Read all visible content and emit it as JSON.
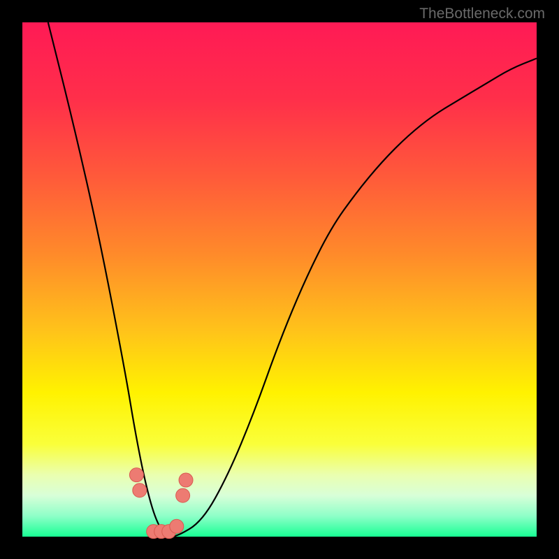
{
  "watermark": "TheBottleneck.com",
  "chart_data": {
    "type": "line",
    "title": "",
    "xlabel": "",
    "ylabel": "",
    "xlim": [
      0,
      100
    ],
    "ylim": [
      0,
      100
    ],
    "series": [
      {
        "name": "curve",
        "x": [
          5,
          10,
          15,
          20,
          22,
          24,
          26,
          28,
          30,
          35,
          40,
          45,
          50,
          55,
          60,
          65,
          70,
          75,
          80,
          85,
          90,
          95,
          100
        ],
        "y": [
          100,
          80,
          58,
          32,
          20,
          10,
          3,
          0,
          0,
          3,
          12,
          24,
          38,
          50,
          60,
          67,
          73,
          78,
          82,
          85,
          88,
          91,
          93
        ]
      }
    ],
    "markers": {
      "x": [
        22.2,
        22.8,
        25.5,
        27.0,
        28.5,
        30.0,
        31.2,
        31.8
      ],
      "y": [
        12,
        9,
        1,
        1,
        1,
        2,
        8,
        11
      ]
    },
    "gradient_stops": [
      {
        "offset": 0,
        "color": "#ff1a55"
      },
      {
        "offset": 15,
        "color": "#ff2f4a"
      },
      {
        "offset": 30,
        "color": "#ff5a3a"
      },
      {
        "offset": 45,
        "color": "#ff8a2a"
      },
      {
        "offset": 60,
        "color": "#ffc31a"
      },
      {
        "offset": 72,
        "color": "#fff200"
      },
      {
        "offset": 82,
        "color": "#faff3a"
      },
      {
        "offset": 88,
        "color": "#eaffb0"
      },
      {
        "offset": 92,
        "color": "#d8ffd8"
      },
      {
        "offset": 96,
        "color": "#8effc8"
      },
      {
        "offset": 100,
        "color": "#18ff94"
      }
    ],
    "marker_color": "#ed7b72",
    "marker_outline": "#d85a50",
    "curve_color": "#000000",
    "plot_border_color": "#000000"
  }
}
